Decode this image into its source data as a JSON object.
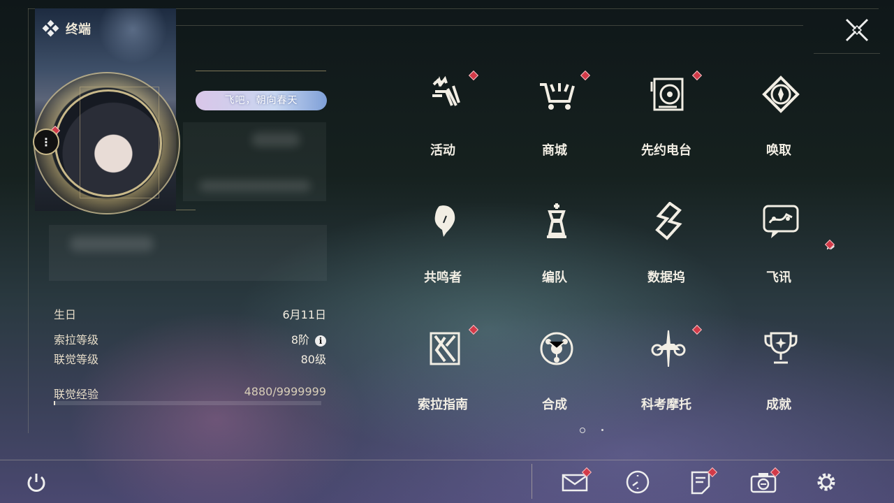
{
  "header": {
    "title": "终端"
  },
  "profile": {
    "tag": "飞吧，朝向春天",
    "stats": [
      {
        "label": "生日",
        "value": "6月11日"
      },
      {
        "label": "索拉等级",
        "value": "8阶"
      },
      {
        "label": "联觉等级",
        "value": "80级"
      }
    ],
    "exp": {
      "label": "联觉经验",
      "value": "4880/9999999",
      "progress": 0.000488
    }
  },
  "menu": [
    {
      "label": "活动",
      "icon": "event-icon",
      "badge": true
    },
    {
      "label": "商城",
      "icon": "shop-cart-icon",
      "badge": true
    },
    {
      "label": "先约电台",
      "icon": "radio-icon",
      "badge": true
    },
    {
      "label": "唤取",
      "icon": "convene-icon",
      "badge": false
    },
    {
      "label": "共鸣者",
      "icon": "resonator-icon",
      "badge": false
    },
    {
      "label": "编队",
      "icon": "team-icon",
      "badge": false
    },
    {
      "label": "数据坞",
      "icon": "data-bank-icon",
      "badge": false
    },
    {
      "label": "飞讯",
      "icon": "chat-icon",
      "badge": false
    },
    {
      "label": "索拉指南",
      "icon": "guide-icon",
      "badge": true
    },
    {
      "label": "合成",
      "icon": "synthesis-icon",
      "badge": false
    },
    {
      "label": "科考摩托",
      "icon": "motorcycle-icon",
      "badge": true
    },
    {
      "label": "成就",
      "icon": "trophy-icon",
      "badge": false
    }
  ],
  "bottom": [
    "mail-icon",
    "clock-icon",
    "notes-icon",
    "camera-icon",
    "settings-icon"
  ],
  "colors": {
    "badge": "#d23a48",
    "text": "#f2eee4",
    "accent": "#c9b98a"
  }
}
